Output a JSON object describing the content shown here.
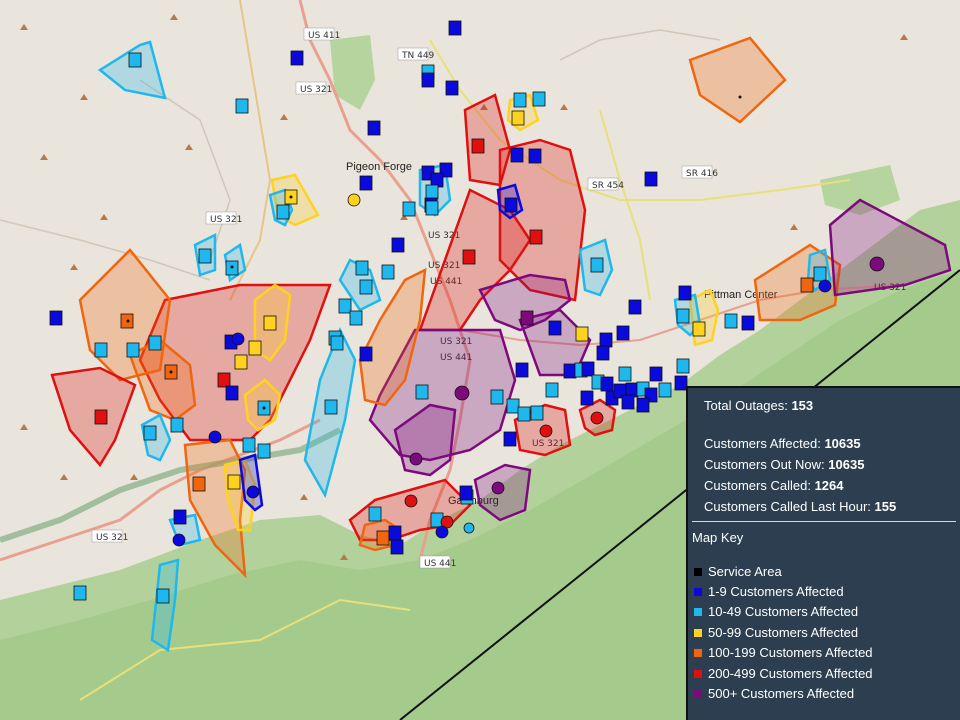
{
  "map": {
    "road_labels": [
      "US 411",
      "TN 449",
      "US 321",
      "US 321",
      "US 321",
      "US 321",
      "US 441",
      "US 321",
      "US 441",
      "SR 454",
      "SR 416",
      "US 321",
      "US 441",
      "US 321",
      "US 321"
    ],
    "place_labels": [
      "Pigeon Forge",
      "Pittman Center",
      "Gatlinburg"
    ]
  },
  "summary": {
    "total_outages_label": "Total Outages:",
    "total_outages_value": "153",
    "customers_affected_label": "Customers Affected:",
    "customers_affected_value": "10635",
    "customers_out_label": "Customers Out Now:",
    "customers_out_value": "10635",
    "customers_called_label": "Customers Called:",
    "customers_called_value": "1264",
    "called_last_hour_label": "Customers Called Last Hour:",
    "called_last_hour_value": "155"
  },
  "legend": {
    "title": "Map Key",
    "items": [
      {
        "label": "Service Area",
        "color": "#000000"
      },
      {
        "label": "1-9 Customers Affected",
        "color": "#0a0adc"
      },
      {
        "label": "10-49 Customers Affected",
        "color": "#1fb8ee"
      },
      {
        "label": "50-99 Customers Affected",
        "color": "#ffd21f"
      },
      {
        "label": "100-199 Customers Affected",
        "color": "#f0650e"
      },
      {
        "label": "200-499 Customers Affected",
        "color": "#e01010"
      },
      {
        "label": "500+ Customers Affected",
        "color": "#7d0a7d"
      }
    ]
  }
}
